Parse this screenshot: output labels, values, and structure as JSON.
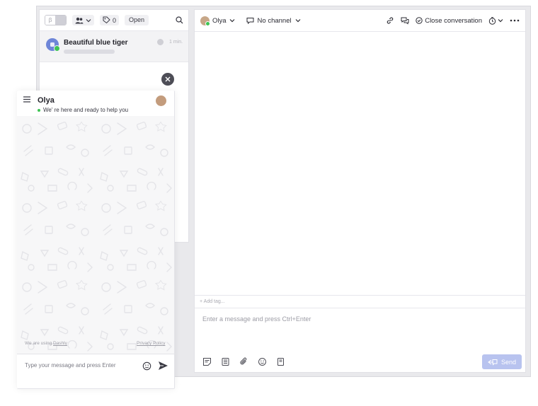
{
  "list": {
    "filter_toggle_label": "β",
    "assignee_chip_label": "",
    "tags_count": "0",
    "status_chip": "Open"
  },
  "conversations": [
    {
      "name": "Beautiful blue tiger",
      "time": "1 min."
    }
  ],
  "header": {
    "agent_name": "Olya",
    "channel_label": "No channel",
    "close_label": "Close conversation"
  },
  "composer": {
    "add_tag_label": "+ Add tag...",
    "placeholder": "Enter a message and press Ctrl+Enter",
    "send_label": "Send"
  },
  "widget": {
    "title": "Olya",
    "status": "We' re here and ready to help you",
    "footer_prefix": "We are using",
    "footer_link": "Dashly",
    "privacy_link": "Privacy Policy",
    "input_placeholder": "Type your message and press Enter"
  },
  "colors": {
    "online": "#3ec454",
    "send_button": "#b8c3ef",
    "conversation_avatar": "#6e86d8"
  },
  "icons": {
    "list_toolbar": [
      "toggle-icon",
      "assignee-icon",
      "tag-icon",
      "search-icon"
    ],
    "header": [
      "link-icon",
      "chat-bubbles-icon",
      "check-circle-icon",
      "timer-icon",
      "more-icon"
    ],
    "composer_tools": [
      "note-icon",
      "template-icon",
      "attach-icon",
      "emoji-icon",
      "article-icon"
    ],
    "widget": [
      "menu-icon",
      "close-icon",
      "emoji-icon",
      "send-icon"
    ]
  }
}
